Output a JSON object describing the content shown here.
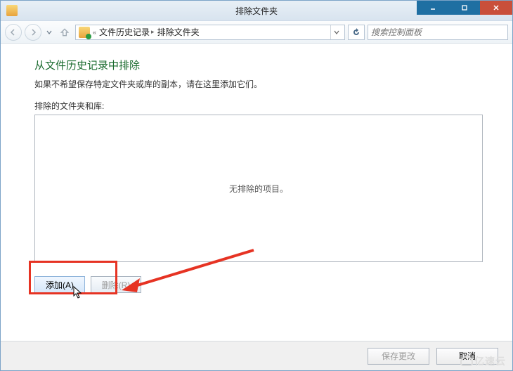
{
  "title_bar": {
    "title": "排除文件夹"
  },
  "nav": {
    "breadcrumb": {
      "prefix": "«",
      "seg1": "文件历史记录",
      "seg2": "排除文件夹"
    },
    "search_placeholder": "搜索控制面板"
  },
  "content": {
    "heading": "从文件历史记录中排除",
    "description": "如果不希望保存特定文件夹或库的副本，请在这里添加它们。",
    "list_label": "排除的文件夹和库:",
    "empty_text": "无排除的项目。",
    "add_button": "添加(A)",
    "remove_button": "删除(R)"
  },
  "footer": {
    "save": "保存更改",
    "cancel": "取消"
  },
  "watermark": "亿速云"
}
